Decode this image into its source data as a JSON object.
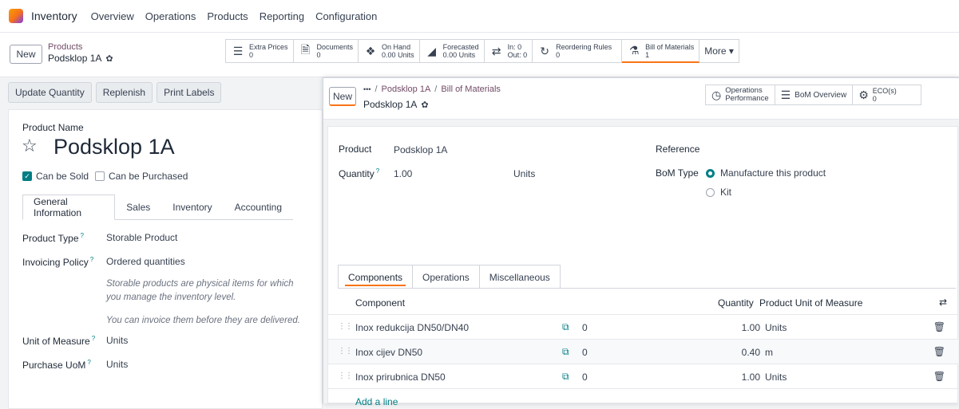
{
  "nav": {
    "app": "Inventory",
    "items": [
      "Overview",
      "Operations",
      "Products",
      "Reporting",
      "Configuration"
    ]
  },
  "control_panel": {
    "new_label": "New",
    "breadcrumb": "Products",
    "record_name": "Podsklop 1A"
  },
  "stat_buttons": [
    {
      "icon": "list-icon",
      "line1": "Extra Prices",
      "line2": "0"
    },
    {
      "icon": "document-icon",
      "line1": "Documents",
      "line2": "0"
    },
    {
      "icon": "cubes-icon",
      "line1": "On Hand",
      "line2": "0.00 Units"
    },
    {
      "icon": "area-chart-icon",
      "line1": "Forecasted",
      "line2": "0.00 Units"
    },
    {
      "icon": "exchange-icon",
      "line1": "In: 0",
      "line2": "Out: 0"
    },
    {
      "icon": "refresh-icon",
      "line1": "Reordering Rules",
      "line2": "0"
    },
    {
      "icon": "flask-icon",
      "line1": "Bill of Materials",
      "line2": "1"
    }
  ],
  "more_label": "More ▾",
  "left_actions": [
    "Update Quantity",
    "Replenish",
    "Print Labels"
  ],
  "product_form": {
    "name_label": "Product Name",
    "name": "Podsklop 1A",
    "can_be_sold": "Can be Sold",
    "can_be_purchased": "Can be Purchased",
    "tabs": [
      "General Information",
      "Sales",
      "Inventory",
      "Accounting"
    ],
    "product_type_label": "Product Type",
    "product_type": "Storable Product",
    "invoicing_policy_label": "Invoicing Policy",
    "invoicing_policy": "Ordered quantities",
    "help1": "Storable products are physical items for which you manage the inventory level.",
    "help2": "You can invoice them before they are delivered.",
    "uom_label": "Unit of Measure",
    "uom": "Units",
    "purchase_uom_label": "Purchase UoM",
    "purchase_uom": "Units"
  },
  "dialog": {
    "new_label": "New",
    "breadcrumb_ellipsis": "•••",
    "breadcrumb_1": "Podsklop 1A",
    "breadcrumb_2": "Bill of Materials",
    "record_name": "Podsklop 1A",
    "stat": {
      "operations_performance_1": "Operations",
      "operations_performance_2": "Performance",
      "bom_overview": "BoM Overview",
      "eco_1": "ECO(s)",
      "eco_2": "0"
    },
    "product_label": "Product",
    "product": "Podsklop 1A",
    "quantity_label": "Quantity",
    "quantity": "1.00",
    "quantity_uom": "Units",
    "reference_label": "Reference",
    "bom_type_label": "BoM Type",
    "bom_type_options": [
      "Manufacture this product",
      "Kit"
    ],
    "tabs": [
      "Components",
      "Operations",
      "Miscellaneous"
    ],
    "columns": {
      "component": "Component",
      "quantity": "Quantity",
      "uom": "Product Unit of Measure"
    },
    "rows": [
      {
        "component": "Inox redukcija DN50/DN40",
        "forecast": "0",
        "quantity": "1.00",
        "uom": "Units"
      },
      {
        "component": "Inox cijev DN50",
        "forecast": "0",
        "quantity": "0.40",
        "uom": "m"
      },
      {
        "component": "Inox prirubnica DN50",
        "forecast": "0",
        "quantity": "1.00",
        "uom": "Units"
      }
    ],
    "add_line": "Add a line"
  }
}
